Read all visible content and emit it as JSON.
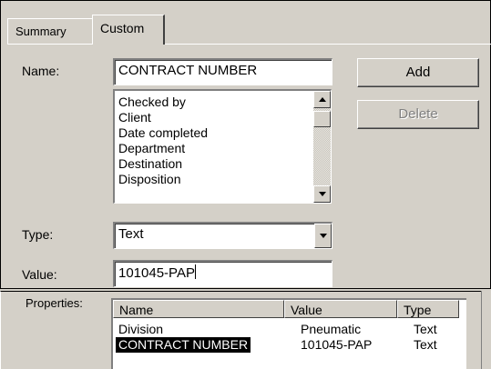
{
  "tabs": [
    {
      "label": "Summary",
      "active": false
    },
    {
      "label": "Custom",
      "active": true
    }
  ],
  "name": {
    "label": "Name:",
    "value": "CONTRACT NUMBER"
  },
  "name_list": {
    "items": [
      "Checked by",
      "Client",
      "Date completed",
      "Department",
      "Destination",
      "Disposition"
    ]
  },
  "buttons": {
    "add": "Add",
    "delete": "Delete"
  },
  "type": {
    "label": "Type:",
    "value": "Text"
  },
  "value": {
    "label": "Value:",
    "value": "101045-PAP"
  },
  "properties": {
    "label": "Properties:",
    "columns": [
      "Name",
      "Value",
      "Type"
    ],
    "rows": [
      {
        "name": "Division",
        "value": "Pneumatic",
        "type": "Text",
        "selected": false
      },
      {
        "name": "CONTRACT NUMBER",
        "value": "101045-PAP",
        "type": "Text",
        "selected": true
      }
    ]
  },
  "colors": {
    "face": "#d4d0c8",
    "selection": "#000000"
  }
}
